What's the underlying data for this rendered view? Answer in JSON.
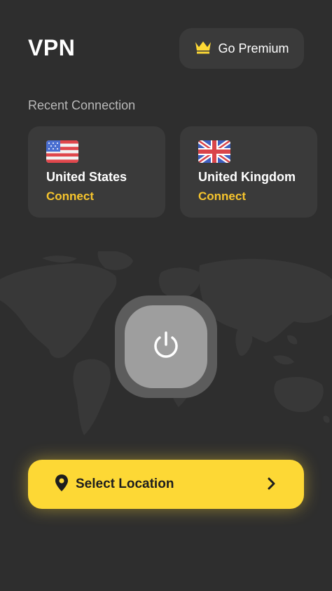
{
  "header": {
    "title": "VPN",
    "premium_label": "Go Premium"
  },
  "recent": {
    "label": "Recent Connection",
    "items": [
      {
        "country": "United States",
        "action": "Connect",
        "flag": "us-flag-icon"
      },
      {
        "country": "United Kingdom",
        "action": "Connect",
        "flag": "uk-flag-icon"
      }
    ]
  },
  "power": {
    "icon": "power-icon"
  },
  "select_location": {
    "label": "Select Location",
    "icon": "location-pin-icon",
    "chevron": "chevron-right-icon"
  },
  "colors": {
    "background": "#2e2e2e",
    "card": "#3a3a3a",
    "accent": "#fdd835",
    "connect_text": "#f7c52d"
  }
}
